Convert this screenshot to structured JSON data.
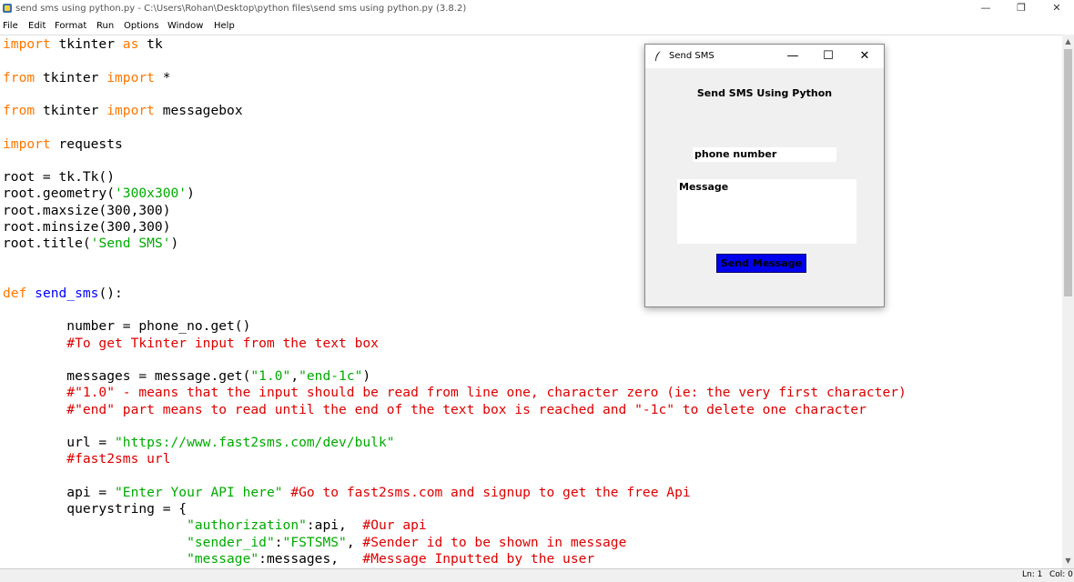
{
  "window": {
    "title": "send sms using python.py - C:\\Users\\Rohan\\Desktop\\python files\\send sms using python.py (3.8.2)",
    "minimize": "—",
    "maximize": "❐",
    "close": "✕"
  },
  "menu": [
    "File",
    "Edit",
    "Format",
    "Run",
    "Options",
    "Window",
    "Help"
  ],
  "code_lines": [
    [
      [
        "kw",
        "import"
      ],
      [
        "tx",
        " tkinter "
      ],
      [
        "kw",
        "as"
      ],
      [
        "tx",
        " tk"
      ]
    ],
    [],
    [
      [
        "kw",
        "from"
      ],
      [
        "tx",
        " tkinter "
      ],
      [
        "kw",
        "import"
      ],
      [
        "tx",
        " *"
      ]
    ],
    [],
    [
      [
        "kw",
        "from"
      ],
      [
        "tx",
        " tkinter "
      ],
      [
        "kw",
        "import"
      ],
      [
        "tx",
        " messagebox"
      ]
    ],
    [],
    [
      [
        "kw",
        "import"
      ],
      [
        "tx",
        " requests"
      ]
    ],
    [],
    [
      [
        "tx",
        "root = tk.Tk()"
      ]
    ],
    [
      [
        "tx",
        "root.geometry("
      ],
      [
        "str",
        "'300x300'"
      ],
      [
        "tx",
        ")"
      ]
    ],
    [
      [
        "tx",
        "root.maxsize(300,300)"
      ]
    ],
    [
      [
        "tx",
        "root.minsize(300,300)"
      ]
    ],
    [
      [
        "tx",
        "root.title("
      ],
      [
        "str",
        "'Send SMS'"
      ],
      [
        "tx",
        ")"
      ]
    ],
    [],
    [],
    [
      [
        "kw",
        "def"
      ],
      [
        "tx",
        " "
      ],
      [
        "df",
        "send_sms"
      ],
      [
        "tx",
        "():"
      ]
    ],
    [],
    [
      [
        "tx",
        "        number = phone_no.get()"
      ]
    ],
    [
      [
        "cm",
        "        #To get Tkinter input from the text box"
      ]
    ],
    [],
    [
      [
        "tx",
        "        messages = message.get("
      ],
      [
        "str",
        "\"1.0\""
      ],
      [
        "tx",
        ","
      ],
      [
        "str",
        "\"end-1c\""
      ],
      [
        "tx",
        ")"
      ]
    ],
    [
      [
        "cm",
        "        #\"1.0\" - means that the input should be read from line one, character zero (ie: the very first character)"
      ]
    ],
    [
      [
        "cm",
        "        #\"end\" part means to read until the end of the text box is reached and \"-1c\" to delete one character"
      ]
    ],
    [],
    [
      [
        "tx",
        "        url = "
      ],
      [
        "str",
        "\"https://www.fast2sms.com/dev/bulk\""
      ]
    ],
    [
      [
        "cm",
        "        #fast2sms url"
      ]
    ],
    [],
    [
      [
        "tx",
        "        api = "
      ],
      [
        "str",
        "\"Enter Your API here\""
      ],
      [
        "tx",
        " "
      ],
      [
        "cm",
        "#Go to fast2sms.com and signup to get the free Api"
      ]
    ],
    [
      [
        "tx",
        "        querystring = {"
      ]
    ],
    [
      [
        "tx",
        "                       "
      ],
      [
        "str",
        "\"authorization\""
      ],
      [
        "tx",
        ":api,  "
      ],
      [
        "cm",
        "#Our api"
      ]
    ],
    [
      [
        "tx",
        "                       "
      ],
      [
        "str",
        "\"sender_id\""
      ],
      [
        "tx",
        ":"
      ],
      [
        "str",
        "\"FSTSMS\""
      ],
      [
        "tx",
        ", "
      ],
      [
        "cm",
        "#Sender id to be shown in message"
      ]
    ],
    [
      [
        "tx",
        "                       "
      ],
      [
        "str",
        "\"message\""
      ],
      [
        "tx",
        ":messages,   "
      ],
      [
        "cm",
        "#Message Inputted by the user"
      ]
    ]
  ],
  "status": {
    "line": "Ln: 1",
    "col": "Col: 0"
  },
  "tk_window": {
    "title": "Send SMS",
    "heading": "Send SMS Using Python",
    "phone_value": "phone number",
    "message_value": "Message",
    "send_button": "Send Message",
    "minimize": "—",
    "maximize": "☐",
    "close": "✕"
  },
  "colors": {
    "keyword": "#ff7700",
    "string": "#00aa00",
    "comment": "#dd0000",
    "def_name": "#0000ff",
    "send_button_bg": "#0000ee"
  }
}
